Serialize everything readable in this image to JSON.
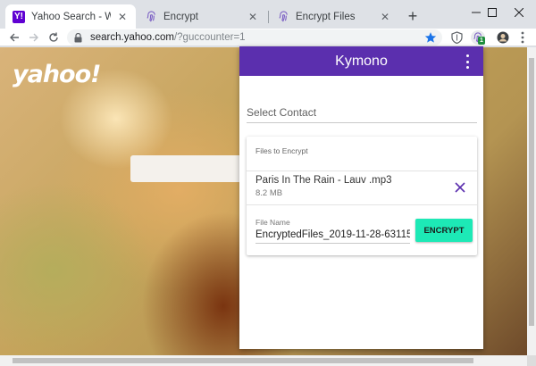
{
  "browser": {
    "tabs": [
      {
        "title": "Yahoo Search - Web Search",
        "favicon": "yahoo-favicon",
        "active": true
      },
      {
        "title": "Encrypt",
        "favicon": "fingerprint-icon",
        "active": false
      },
      {
        "title": "Encrypt Files",
        "favicon": "fingerprint-icon",
        "active": false
      }
    ],
    "favicon_letter": "Y!",
    "close_glyph": "✕",
    "new_tab_glyph": "+",
    "address": {
      "host": "search.yahoo.com",
      "path": "/?guccounter=1"
    },
    "extension_badge": "1"
  },
  "page": {
    "logo": "yahoo!"
  },
  "popup": {
    "title": "Kymono",
    "contact_placeholder": "Select Contact",
    "files_header": "Files to Encrypt",
    "file": {
      "name": "Paris In The Rain - Lauv .mp3",
      "size": "8.2 MB"
    },
    "filename_label": "File Name",
    "filename_value": "EncryptedFiles_2019-11-28-63115",
    "encrypt_label": "ENCRYPT",
    "colors": {
      "header": "#5b2fae",
      "button": "#1de9b6",
      "remove_icon": "#5b2fae"
    }
  }
}
